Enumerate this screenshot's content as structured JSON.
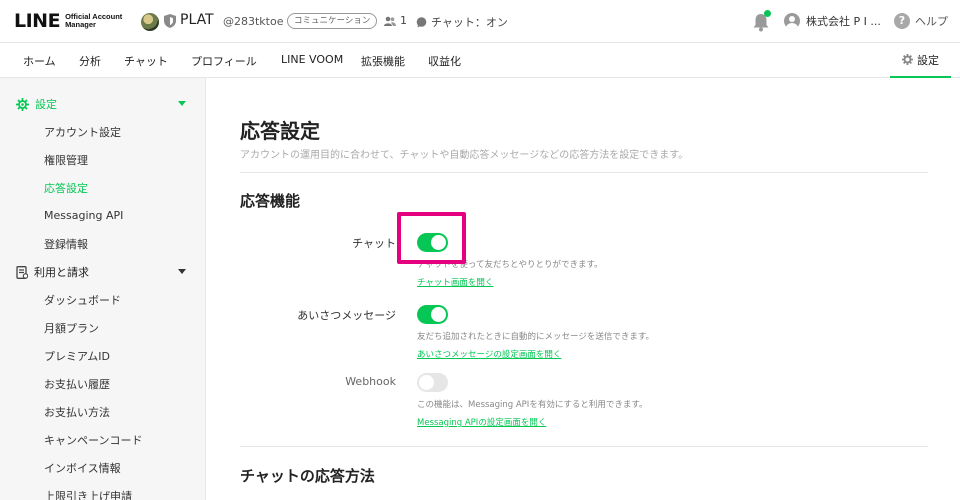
{
  "header": {
    "logo_main": "LINE",
    "logo_sub": "Official Account Manager",
    "account_name": "PLAT",
    "account_id": "@283tktoe",
    "badge": "コミュニケーション",
    "friends_count": "1",
    "chat_status": "チャット：オン",
    "user_name": "株式会社 P I ...",
    "help_label": "ヘルプ"
  },
  "nav": {
    "items": [
      "ホーム",
      "分析",
      "チャット",
      "プロフィール",
      "LINE VOOM",
      "拡張機能",
      "収益化"
    ],
    "settings": "設定"
  },
  "sidebar": {
    "group_settings": "設定",
    "settings_items": [
      "アカウント設定",
      "権限管理",
      "応答設定",
      "Messaging API",
      "登録情報"
    ],
    "group_billing": "利用と請求",
    "billing_items": [
      "ダッシュボード",
      "月額プラン",
      "プレミアムID",
      "お支払い履歴",
      "お支払い方法",
      "キャンペーンコード",
      "インボイス情報",
      "上限引き上げ申請"
    ]
  },
  "main": {
    "title": "応答設定",
    "description": "アカウントの運用目的に合わせて、チャットや自動応答メッセージなどの応答方法を設定できます。",
    "section_features": "応答機能",
    "chat": {
      "label": "チャット",
      "enabled": true,
      "description": "チャットを使って友だちとやりとりができます。",
      "link": "チャット画面を開く"
    },
    "greeting": {
      "label": "あいさつメッセージ",
      "enabled": true,
      "description": "友だち追加されたときに自動的にメッセージを送信できます。",
      "link": "あいさつメッセージの設定画面を開く"
    },
    "webhook": {
      "label": "Webhook",
      "enabled": false,
      "description": "この機能は、Messaging APIを有効にすると利用できます。",
      "link": "Messaging APIの設定画面を開く"
    },
    "section_method": "チャットの応答方法"
  },
  "colors": {
    "accent": "#06c755",
    "highlight": "#e4007f"
  }
}
